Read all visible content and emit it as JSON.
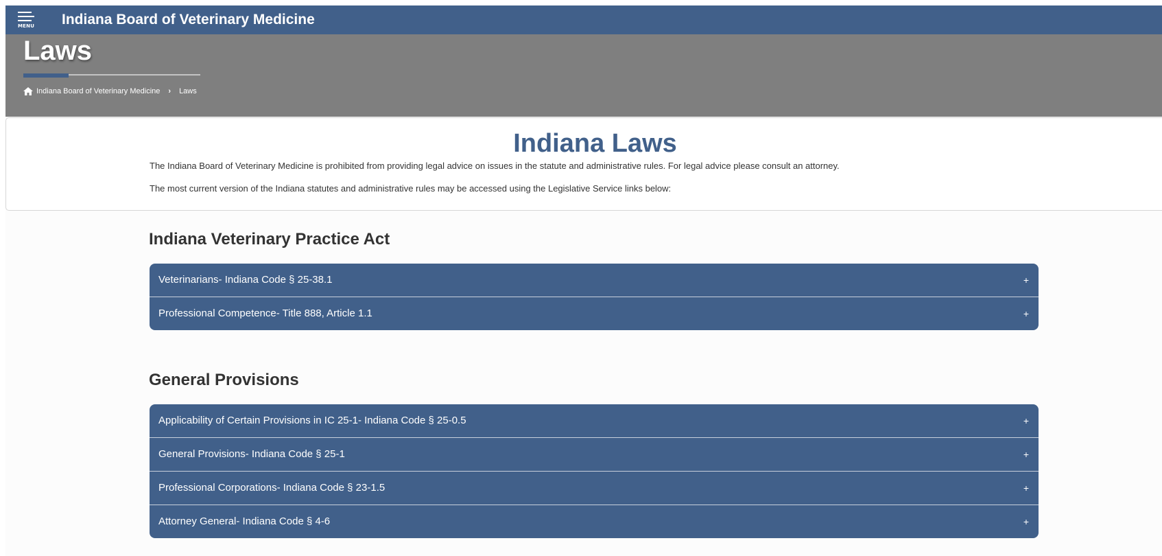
{
  "header": {
    "menu_label": "MENU",
    "site_title": "Indiana Board of Veterinary Medicine",
    "bar_color": "#41608a"
  },
  "banner": {
    "title": "Laws",
    "background_color": "#7f7f7f",
    "breadcrumb": {
      "home_icon": "home-icon",
      "items": [
        "Indiana Board of Veterinary Medicine",
        "Laws"
      ]
    }
  },
  "intro": {
    "heading": "Indiana Laws",
    "paragraphs": [
      "The Indiana Board of Veterinary Medicine is prohibited from providing legal advice on issues in the statute and administrative rules. For legal advice please consult an attorney.",
      "The most current version of the Indiana statutes and administrative rules may be accessed using the Legislative Service links below:"
    ]
  },
  "sections": [
    {
      "title": "Indiana Veterinary Practice Act",
      "items": [
        {
          "label": "Veterinarians- Indiana Code § 25-38.1",
          "toggle": "+"
        },
        {
          "label": "Professional Competence- Title 888, Article 1.1",
          "toggle": "+"
        }
      ]
    },
    {
      "title": "General Provisions",
      "items": [
        {
          "label": "Applicability of Certain Provisions in IC 25-1- Indiana Code § 25-0.5",
          "toggle": "+"
        },
        {
          "label": "General Provisions- Indiana Code § 25-1",
          "toggle": "+"
        },
        {
          "label": "Professional Corporations- Indiana Code § 23-1.5",
          "toggle": "+"
        },
        {
          "label": "Attorney General- Indiana Code § 4-6",
          "toggle": "+"
        }
      ]
    }
  ],
  "colors": {
    "accent": "#41608a",
    "text": "#333333"
  }
}
